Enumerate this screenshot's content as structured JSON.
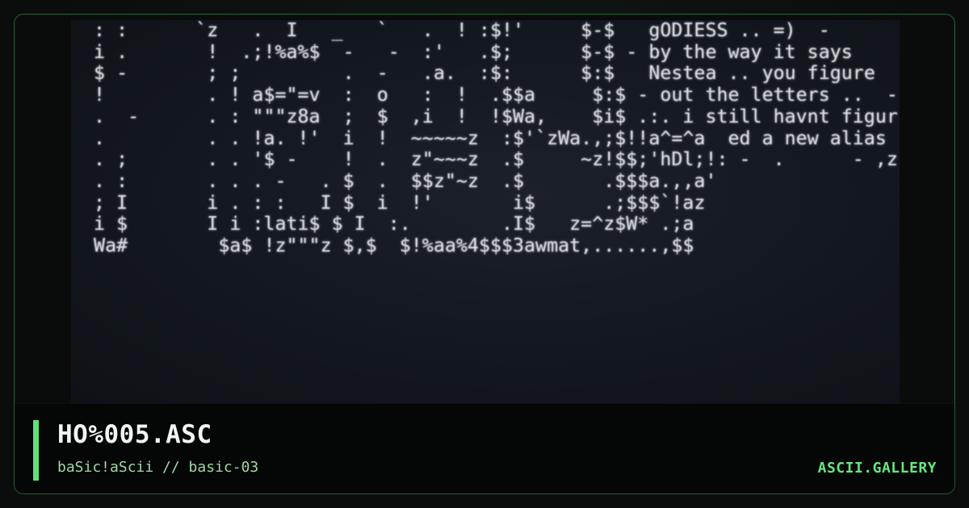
{
  "artwork": {
    "lines": [
      "  : :      `z   .  I   _   `   .  ! :$!'     $-$   gODIESS .. =)  -",
      "  i .       !  .;!%a%$  -   -  :'   .$;      $-$ - by the way it says",
      "  $ -       ; ;         .  -   .a.  :$:      $:$   Nestea .. you figure",
      "  !         . ! a$=\"=v  :  o   :  !  .$$a     $:$ - out the letters ..  -",
      "  .  -      . : \"\"\"z8a  ;  $  ,i  !  !$Wa,    $i$ .:. i still havnt figur",
      "  .         . . !a. !'  i  !  ~~~~~z  :$'`zWa.,;$!!a^=^a  ed a new alias",
      "  . ;       . . '$ -    !  .  z\"~~~z  .$     ~z!$$;'hDl;!: -  .      - ,z",
      "  . :       . . . -   . $  .  $$z\"~z  .$       .$$$a.,,a'",
      "  ; I       i . : :   I $  i  !'       i$      .;$$$`!az",
      "  i $       I i :lati$ $ I  :.        .I$   z=^z$W* .;a",
      "  Wa#        $a$ !z\"\"\"z $,$  $!%aa%4$$$3awmat,......,$$"
    ]
  },
  "footer": {
    "title": "HO%005.ASC",
    "subtitle": "baSic!aScii // basic-03",
    "brand": "ASCII.GALLERY"
  }
}
